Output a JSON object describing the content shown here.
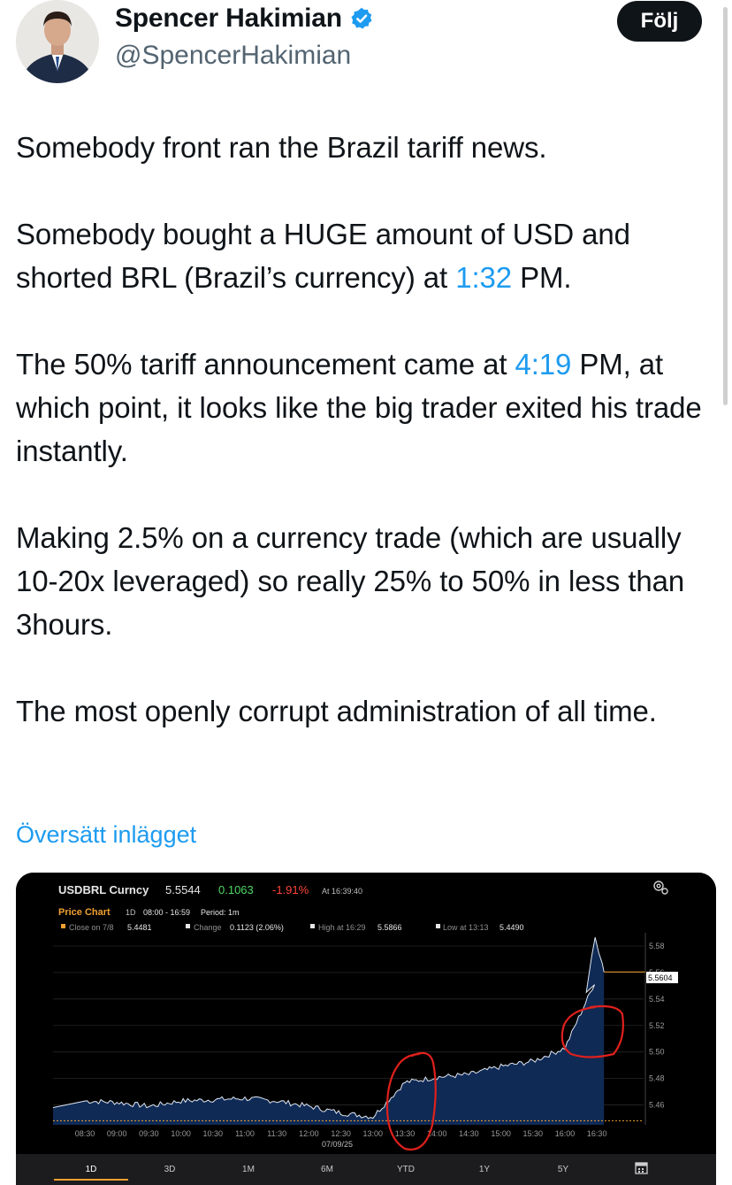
{
  "author": {
    "name": "Spencer Hakimian",
    "handle": "@SpencerHakimian",
    "follow_label": "Följ"
  },
  "tweet": {
    "p1": "Somebody front ran the Brazil tariff news.",
    "p2_a": "Somebody bought a HUGE amount of USD and shorted BRL (Brazil’s currency) at ",
    "p2_link": "1:32",
    "p2_b": " PM.",
    "p3_a": "The 50% tariff announcement came at ",
    "p3_link": "4:19",
    "p3_b": " PM, at which point, it looks like the big trader exited his trade instantly.",
    "p4": "Making 2.5% on a currency trade (which are usually 10-20x leveraged) so really 25% to 50% in less than 3hours.",
    "p5": "The most openly corrupt administration of all time."
  },
  "translate_label": "Översätt inlägget",
  "terminal": {
    "ticker": "USDBRL Curncy",
    "last": "5.5544",
    "change": "0.1063",
    "pct": "-1.91%",
    "time": "At 16:39:40",
    "price_chart": "Price Chart",
    "period_1d": "1D",
    "session": "08:00 - 16:59",
    "interval": "Period: 1m",
    "close_label": "Close on 7/8",
    "close_value": "5.4481",
    "change_label": "Change",
    "change_value": "0.1123 (2.06%)",
    "high_label": "High at 16:29",
    "high_value": "5.5866",
    "low_label": "Low at 13:13",
    "low_value": "5.4490",
    "date_label": "07/09/25",
    "current_marker": "5.5604",
    "ranges": [
      "1D",
      "3D",
      "1M",
      "6M",
      "YTD",
      "1Y",
      "5Y"
    ],
    "selected_range": "1D"
  },
  "colors": {
    "accent": "#1d9bf0",
    "bbg_orange": "#f0a030",
    "bbg_green": "#4cd964",
    "bbg_red": "#ff453a",
    "area_fill": "#0f2a55",
    "circle_red": "#e0201c"
  },
  "chart_data": {
    "type": "area",
    "x": [
      "08:30",
      "09:00",
      "09:30",
      "10:00",
      "10:30",
      "11:00",
      "11:30",
      "12:00",
      "12:30",
      "13:00",
      "13:30",
      "14:00",
      "14:30",
      "15:00",
      "15:30",
      "16:00",
      "16:30"
    ],
    "y_ticks": [
      "5.46",
      "5.48",
      "5.50",
      "5.52",
      "5.54",
      "5.56",
      "5.58"
    ],
    "ylim": [
      5.445,
      5.59
    ],
    "series": [
      {
        "values": [
          5.463,
          5.462,
          5.459,
          5.463,
          5.464,
          5.465,
          5.463,
          5.459,
          5.454,
          5.451,
          5.477,
          5.481,
          5.483,
          5.489,
          5.493,
          5.503,
          5.556
        ]
      }
    ],
    "reference_line": 5.4481,
    "grid": true
  }
}
